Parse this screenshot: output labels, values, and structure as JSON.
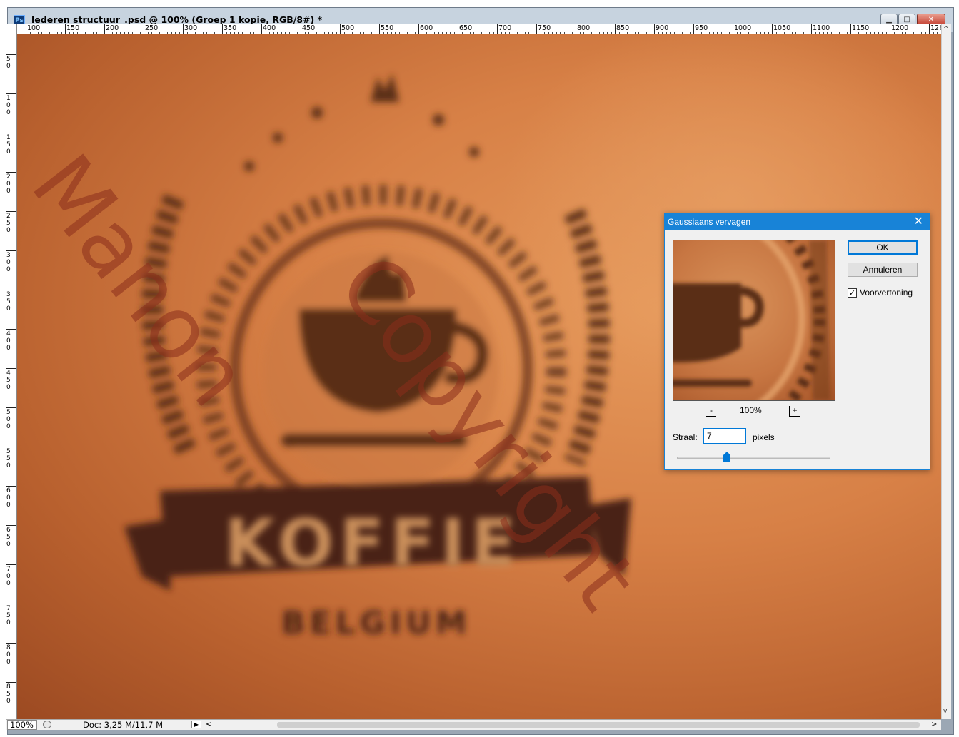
{
  "window": {
    "app_icon": "Ps",
    "title": "lederen structuur_.psd @ 100% (Groep 1 kopie, RGB/8#) *",
    "min_icon": "minimize-icon",
    "max_icon": "maximize-icon",
    "close_icon": "close-icon"
  },
  "ruler": {
    "top_labels": [
      "100",
      "150",
      "200",
      "250",
      "300",
      "350",
      "400",
      "450",
      "500",
      "550",
      "600",
      "650",
      "700",
      "750",
      "800",
      "850",
      "900",
      "950",
      "1000",
      "1050",
      "1100",
      "1150",
      "1200",
      "12!"
    ],
    "left_labels": [
      "5\n0",
      "1\n0\n0",
      "1\n5\n0",
      "2\n0\n0",
      "2\n5\n0",
      "3\n0\n0",
      "3\n5\n0",
      "4\n0\n0",
      "4\n5\n0",
      "5\n0\n0",
      "5\n5\n0",
      "6\n0\n0",
      "6\n5\n0",
      "7\n0\n0",
      "7\n5\n0",
      "8\n0\n0",
      "8\n5\n0"
    ]
  },
  "canvas": {
    "logo_word": "KOFFIE",
    "logo_sub": "BELGIUM"
  },
  "status": {
    "zoom": "100%",
    "doc": "Doc: 3,25 M/11,7 M",
    "arrow": "▶",
    "scroll_left": "<",
    "scroll_right": ">"
  },
  "scrollbar": {
    "up": "^",
    "down": "v"
  },
  "dialog": {
    "title": "Gaussiaans vervagen",
    "close": "✕",
    "ok": "OK",
    "cancel": "Annuleren",
    "preview_label": "Voorvertoning",
    "preview_checked": "✓",
    "zoom_minus": "-",
    "zoom_plus": "+",
    "zoom_level": "100%",
    "radius_label": "Straal:",
    "radius_value": "7",
    "unit": "pixels"
  },
  "watermark": {
    "text1": "Manon",
    "text2": "Copyright"
  },
  "colors": {
    "accent": "#1883d7",
    "leather": "#d78046"
  }
}
